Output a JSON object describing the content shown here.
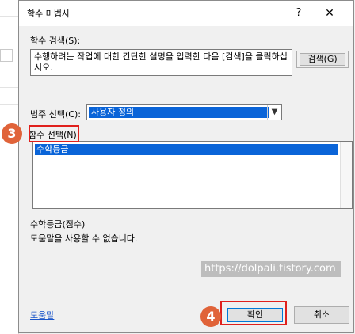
{
  "dialog": {
    "title": "함수 마법사",
    "help_label": "?",
    "close_label": "✕"
  },
  "search": {
    "section_label": "함수 검색(S):",
    "description": "수행하려는 작업에 대한 간단한 설명을 입력한 다음 [검색]을 클릭하십시오.",
    "search_button": "검색(G)"
  },
  "category": {
    "label": "범주 선택(C):",
    "selected_value": "사용자 정의"
  },
  "functions": {
    "label": "함수 선택(N):",
    "items": [
      "수학등급"
    ],
    "signature": "수학등급(점수)",
    "help_text": "도움말을 사용할 수 없습니다."
  },
  "footer": {
    "help_link": "도움말",
    "ok_button": "확인",
    "cancel_button": "취소"
  },
  "annotations": {
    "badge_3": "3",
    "badge_4": "4",
    "watermark": "https://dolpali.tistory.com"
  },
  "colors": {
    "selection": "#0a64d8",
    "highlight": "#e0201c",
    "badge": "#e06339",
    "link": "#1a55c9"
  }
}
